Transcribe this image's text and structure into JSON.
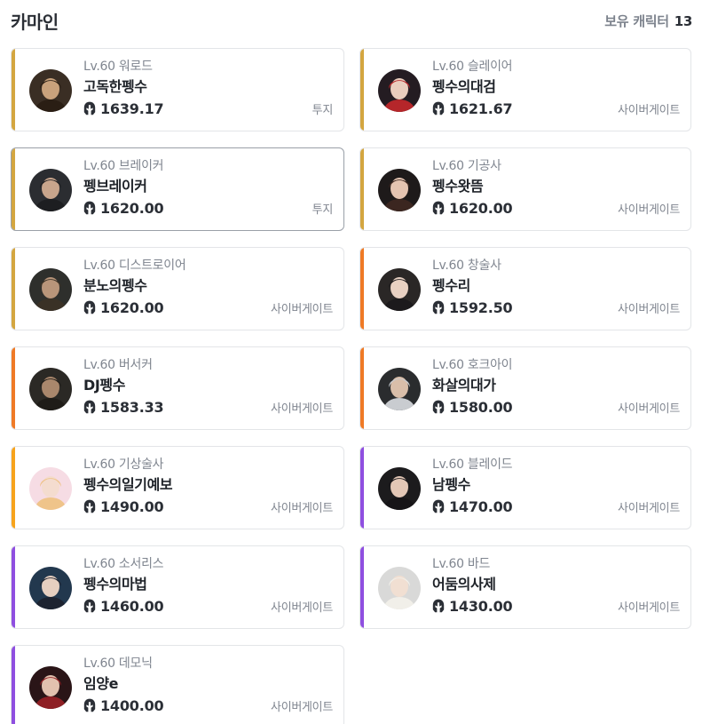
{
  "header": {
    "server_name": "카마인",
    "owned_label": "보유 캐릭터",
    "owned_count": "13"
  },
  "colors": {
    "gold": "#d4a640",
    "orange": "#ef7a26",
    "yellow_orange": "#f7a31c",
    "purple": "#8f4fe0",
    "icon": "#2b2f36"
  },
  "icons": {
    "item_level": "helmet-icon"
  },
  "characters": [
    {
      "level": "Lv.60 워로드",
      "name": "고독한펭수",
      "item_level": "1639.17",
      "guild": "투지",
      "tier_color": "#d4a640",
      "selected": false,
      "avatar_bg": "#3a2e24",
      "hair": "#2a1e14",
      "skin": "#c9a27c"
    },
    {
      "level": "Lv.60 슬레이어",
      "name": "펭수의대검",
      "item_level": "1621.67",
      "guild": "사이버게이트",
      "tier_color": "#d4a640",
      "selected": false,
      "avatar_bg": "#241c22",
      "hair": "#b5262a",
      "skin": "#e9cdbd"
    },
    {
      "level": "Lv.60 브레이커",
      "name": "펭브레이커",
      "item_level": "1620.00",
      "guild": "투지",
      "tier_color": "#d4a640",
      "selected": true,
      "avatar_bg": "#2b2d31",
      "hair": "#1d1e21",
      "skin": "#c8a58c"
    },
    {
      "level": "Lv.60 기공사",
      "name": "펭수왓뜸",
      "item_level": "1620.00",
      "guild": "사이버게이트",
      "tier_color": "#d4a640",
      "selected": false,
      "avatar_bg": "#1e1a1a",
      "hair": "#3b2620",
      "skin": "#e4c4b1"
    },
    {
      "level": "Lv.60 디스트로이어",
      "name": "분노의펭수",
      "item_level": "1620.00",
      "guild": "사이버게이트",
      "tier_color": "#d4a640",
      "selected": false,
      "avatar_bg": "#2e2f2c",
      "hair": "#3a3126",
      "skin": "#b8957a"
    },
    {
      "level": "Lv.60 창술사",
      "name": "펭수리",
      "item_level": "1592.50",
      "guild": "사이버게이트",
      "tier_color": "#ef7a26",
      "selected": false,
      "avatar_bg": "#2a2726",
      "hair": "#1c1a1c",
      "skin": "#e8d1c2"
    },
    {
      "level": "Lv.60 버서커",
      "name": "DJ펭수",
      "item_level": "1583.33",
      "guild": "사이버게이트",
      "tier_color": "#ef7a26",
      "selected": false,
      "avatar_bg": "#2b2925",
      "hair": "#1f1c18",
      "skin": "#a9876c"
    },
    {
      "level": "Lv.60 호크아이",
      "name": "화살의대가",
      "item_level": "1580.00",
      "guild": "사이버게이트",
      "tier_color": "#ef7a26",
      "selected": false,
      "avatar_bg": "#2a2c2e",
      "hair": "#c9ccd0",
      "skin": "#d9bea9"
    },
    {
      "level": "Lv.60 기상술사",
      "name": "펭수의일기예보",
      "item_level": "1490.00",
      "guild": "사이버게이트",
      "tier_color": "#f7a31c",
      "selected": false,
      "avatar_bg": "#f6dce4",
      "hair": "#efc48a",
      "skin": "#f4dccf"
    },
    {
      "level": "Lv.60 블레이드",
      "name": "남펭수",
      "item_level": "1470.00",
      "guild": "사이버게이트",
      "tier_color": "#8f4fe0",
      "selected": false,
      "avatar_bg": "#1c1b1d",
      "hair": "#161417",
      "skin": "#e3c7b6"
    },
    {
      "level": "Lv.60 소서리스",
      "name": "펭수의마법",
      "item_level": "1460.00",
      "guild": "사이버게이트",
      "tier_color": "#8f4fe0",
      "selected": false,
      "avatar_bg": "#22384e",
      "hair": "#1d2330",
      "skin": "#e6cfc0"
    },
    {
      "level": "Lv.60 바드",
      "name": "어둠의사제",
      "item_level": "1430.00",
      "guild": "사이버게이트",
      "tier_color": "#8f4fe0",
      "selected": false,
      "avatar_bg": "#d9d9d8",
      "hair": "#f1efe9",
      "skin": "#f1dfd2"
    },
    {
      "level": "Lv.60 데모닉",
      "name": "임양e",
      "item_level": "1400.00",
      "guild": "사이버게이트",
      "tier_color": "#8f4fe0",
      "selected": false,
      "avatar_bg": "#2a1517",
      "hair": "#8e1f24",
      "skin": "#e2c1ae"
    }
  ]
}
